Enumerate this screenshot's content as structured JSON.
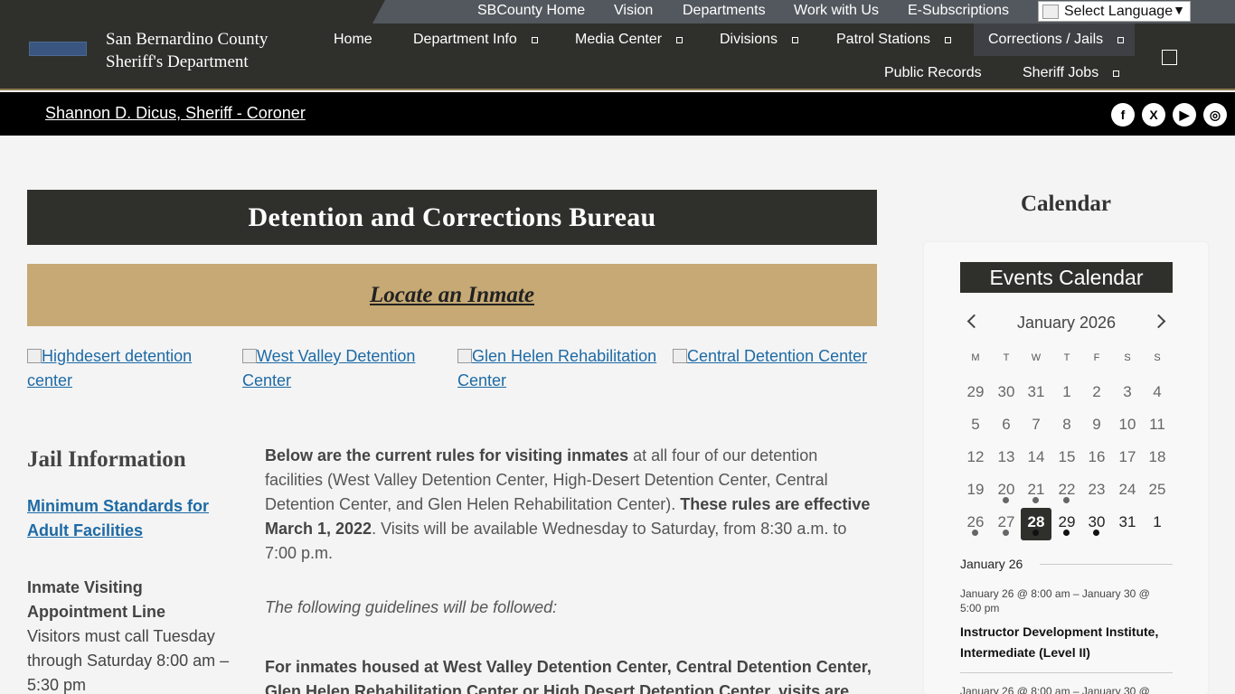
{
  "utility": {
    "links": [
      "SBCounty Home",
      "Vision",
      "Departments",
      "Work with Us",
      "E-Subscriptions"
    ],
    "language": "Select Language"
  },
  "header": {
    "logo_alt": "sheriff-logo",
    "site_name": "San Bernardino County Sheriff's Department",
    "nav": [
      "Home",
      "Department Info",
      "Media Center",
      "Divisions",
      "Patrol Stations",
      "Corrections / Jails",
      "Public Records",
      "Sheriff Jobs"
    ]
  },
  "sheriff_bar": {
    "sheriff_link": "Shannon D. Dicus, Sheriff - Coroner",
    "social": [
      "facebook",
      "x",
      "youtube",
      "instagram"
    ]
  },
  "main": {
    "page_title": "Detention and Corrections Bureau",
    "locate": "Locate an Inmate",
    "facilities": [
      "Highdesert detention center",
      "West Valley Detention Center",
      "Glen Helen Rehabilitation Center",
      "Central Detention Center"
    ],
    "jail_heading": "Jail Information",
    "min_standards": "Minimum Standards for Adult Facilities",
    "visit_line_title": "Inmate Visiting Appointment Line",
    "visit_line_text": "Visitors must call Tuesday through Saturday 8:00 am – 5:30 pm",
    "rules_bold_1": "Below are the current rules for visiting inmates",
    "rules_text_1": " at all four of our detention facilities (West Valley Detention Center, High-Desert Detention Center, Central Detention Center, and Glen Helen Rehabilitation Center).  ",
    "rules_bold_2": "These rules are effective March 1, 2022",
    "rules_text_2": ".  Visits will be available Wednesday to Saturday, from 8:30 a.m. to 7:00 p.m.",
    "guidelines": "The following guidelines will be followed:",
    "inmates_para": "For inmates housed at West Valley Detention Center, Central Detention Center, Glen Helen Rehabilitation Center or High Desert Detention Center, visits are"
  },
  "sidebar": {
    "heading": "Calendar",
    "events_title": "Events Calendar",
    "month": "January 2026",
    "weekdays": [
      "M",
      "T",
      "W",
      "T",
      "F",
      "S",
      "S"
    ],
    "weeks": [
      [
        "29",
        "30",
        "31",
        "1",
        "2",
        "3",
        "4"
      ],
      [
        "5",
        "6",
        "7",
        "8",
        "9",
        "10",
        "11"
      ],
      [
        "12",
        "13",
        "14",
        "15",
        "16",
        "17",
        "18"
      ],
      [
        "19",
        "20",
        "21",
        "22",
        "23",
        "24",
        "25"
      ],
      [
        "26",
        "27",
        "28",
        "29",
        "30",
        "31",
        "1"
      ]
    ],
    "list_date": "January 26",
    "event_time": "January 26 @ 8:00 am – January 30 @ 5:00 pm",
    "event_title": "Instructor Development Institute, Intermediate (Level II)",
    "event_time_2": "January 26 @ 8:00 am – January 30 @"
  }
}
